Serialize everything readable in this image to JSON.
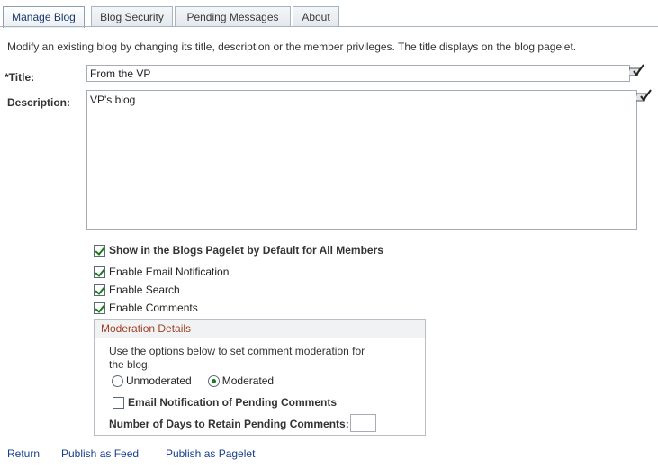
{
  "tabs": [
    {
      "label": "Manage Blog",
      "active": true
    },
    {
      "label": "Blog Security",
      "active": false
    },
    {
      "label": "Pending Messages",
      "active": false
    },
    {
      "label": "About",
      "active": false
    }
  ],
  "intro": "Modify an existing blog by changing its title, description or the member privileges. The title displays on the blog pagelet.",
  "title_field": {
    "label": "*Title:",
    "value": "From the VP"
  },
  "description_field": {
    "label": "Description:",
    "value": "VP's blog"
  },
  "options": {
    "show_in_pagelet": {
      "label": "Show in the Blogs Pagelet by Default for All Members",
      "checked": true
    },
    "email_notification": {
      "label": "Enable Email Notification",
      "checked": true
    },
    "search": {
      "label": "Enable Search",
      "checked": true
    },
    "comments": {
      "label": "Enable Comments",
      "checked": true
    }
  },
  "moderation": {
    "header": "Moderation Details",
    "description": "Use the options below to set comment moderation for the blog.",
    "unmoderated_label": "Unmoderated",
    "moderated_label": "Moderated",
    "selected": "Moderated",
    "email_pending_label": "Email Notification of Pending Comments",
    "email_pending_checked": false,
    "days_label": "Number of Days to Retain Pending Comments:",
    "days_value": ""
  },
  "footer": {
    "return": "Return",
    "publish_feed": "Publish as Feed",
    "publish_pagelet": "Publish as Pagelet"
  },
  "colors": {
    "group_header_text": "#a14224",
    "link": "#1a3f8c",
    "check": "#1a7a1a"
  }
}
